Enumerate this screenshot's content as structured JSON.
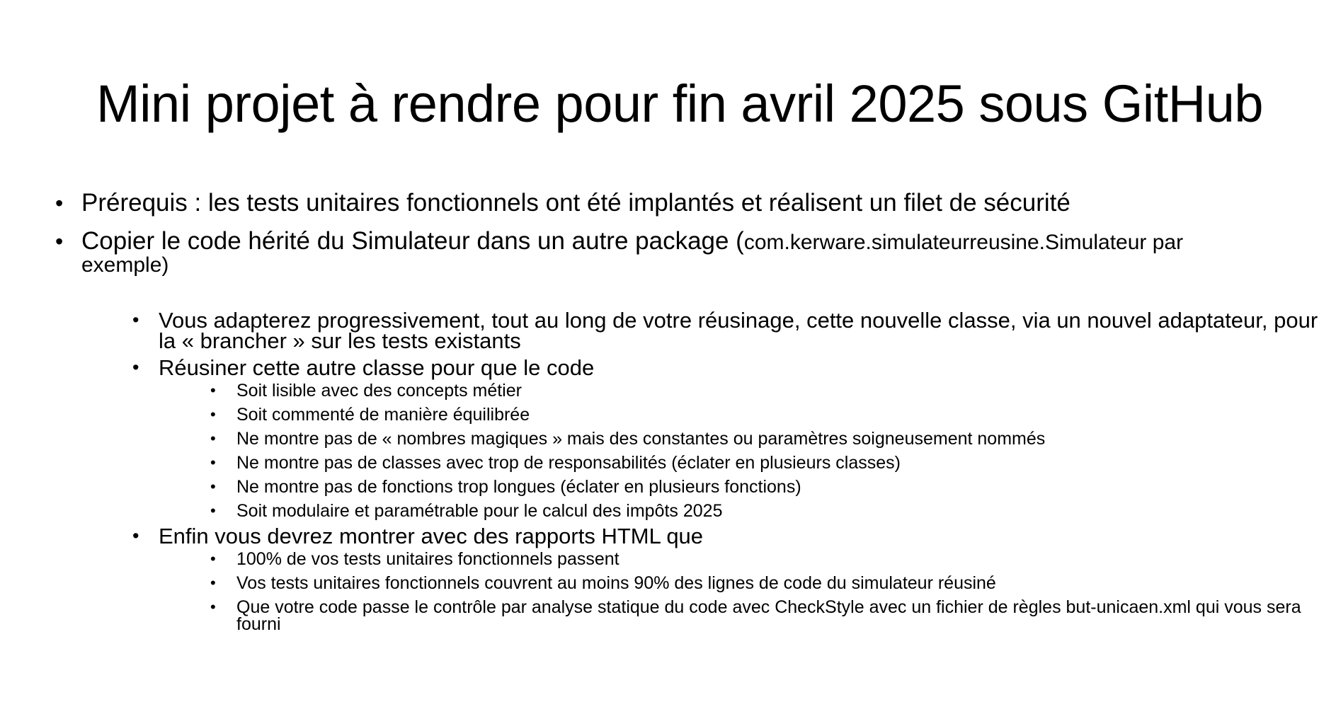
{
  "slide": {
    "title": "Mini projet à rendre pour fin avril 2025 sous GitHub",
    "bullet_symbol": "•",
    "items": [
      {
        "text": "Prérequis : les tests unitaires fonctionnels ont été implantés et réalisent un filet de sécurité"
      },
      {
        "text": "Copier le code hérité du Simulateur dans un autre package (",
        "small_text": "com.kerware.simulateurreusine.Simulateur par",
        "tail_text": "exemple)"
      }
    ],
    "sub_items": [
      {
        "text": "Vous adapterez progressivement, tout au long de votre réusinage, cette nouvelle classe, via un nouvel adaptateur, pour la « brancher » sur les tests existants"
      },
      {
        "text": "Réusiner cette autre classe pour que le code",
        "children": [
          "Soit lisible avec des concepts métier",
          "Soit commenté de manière équilibrée",
          "Ne montre pas de « nombres magiques » mais des constantes ou paramètres soigneusement nommés",
          "Ne montre pas de classes avec trop de responsabilités (éclater en plusieurs classes)",
          "Ne montre pas de fonctions trop longues (éclater en plusieurs fonctions)",
          "Soit modulaire et paramétrable pour le calcul des impôts 2025"
        ]
      },
      {
        "text": "Enfin vous devrez montrer avec des rapports HTML que",
        "children": [
          "100% de vos tests unitaires fonctionnels passent",
          "Vos tests unitaires fonctionnels couvrent au moins 90% des lignes de code du simulateur réusiné",
          "Que votre code passe le contrôle par analyse statique du code avec CheckStyle avec un fichier de règles but-unicaen.xml qui vous sera fourni"
        ]
      }
    ]
  }
}
